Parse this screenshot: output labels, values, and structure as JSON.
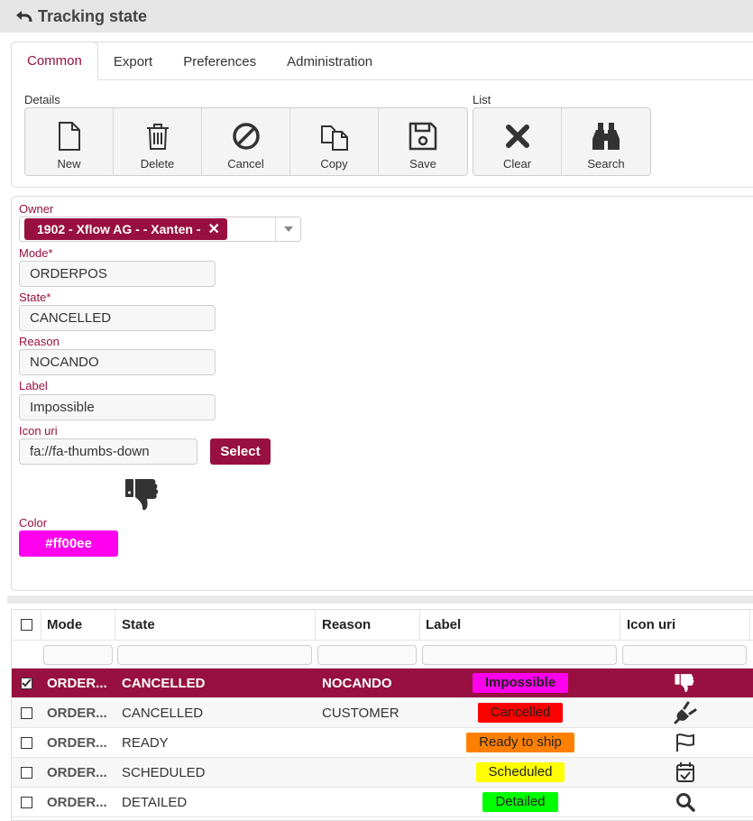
{
  "header": {
    "title": "Tracking state"
  },
  "tabs": [
    {
      "label": "Common",
      "active": true
    },
    {
      "label": "Export",
      "active": false
    },
    {
      "label": "Preferences",
      "active": false
    },
    {
      "label": "Administration",
      "active": false
    }
  ],
  "toolbar": {
    "details_label": "Details",
    "list_label": "List",
    "new": "New",
    "delete": "Delete",
    "cancel": "Cancel",
    "copy": "Copy",
    "save": "Save",
    "clear": "Clear",
    "search": "Search"
  },
  "form": {
    "owner_label": "Owner",
    "owner_value": "1902 - Xflow AG - - Xanten -",
    "mode_label": "Mode",
    "mode_value": "ORDERPOS",
    "state_label": "State",
    "state_value": "CANCELLED",
    "reason_label": "Reason",
    "reason_value": "NOCANDO",
    "label_label": "Label",
    "label_value": "Impossible",
    "icon_uri_label": "Icon uri",
    "icon_uri_value": "fa://fa-thumbs-down",
    "select_button": "Select",
    "icon_preview": "thumbs-down-icon",
    "color_label": "Color",
    "color_value": "#ff00ee"
  },
  "grid": {
    "columns": [
      "Mode",
      "State",
      "Reason",
      "Label",
      "Icon uri"
    ],
    "rows": [
      {
        "selected": true,
        "mode": "ORDER...",
        "state": "CANCELLED",
        "reason": "NOCANDO",
        "label": "Impossible",
        "color": "#ff00ee",
        "icon": "thumbs-down-icon"
      },
      {
        "selected": false,
        "mode": "ORDER...",
        "state": "CANCELLED",
        "reason": "CUSTOMER",
        "label": "Cancelled",
        "color": "#ff0000",
        "icon": "plug-icon"
      },
      {
        "selected": false,
        "mode": "ORDER...",
        "state": "READY",
        "reason": "",
        "label": "Ready to ship",
        "color": "#ff8000",
        "icon": "flag-icon"
      },
      {
        "selected": false,
        "mode": "ORDER...",
        "state": "SCHEDULED",
        "reason": "",
        "label": "Scheduled",
        "color": "#ffff00",
        "icon": "calendar-check-icon"
      },
      {
        "selected": false,
        "mode": "ORDER...",
        "state": "DETAILED",
        "reason": "",
        "label": "Detailed",
        "color": "#00ff00",
        "icon": "search-icon"
      }
    ]
  },
  "colors": {
    "accent": "#98103f"
  }
}
